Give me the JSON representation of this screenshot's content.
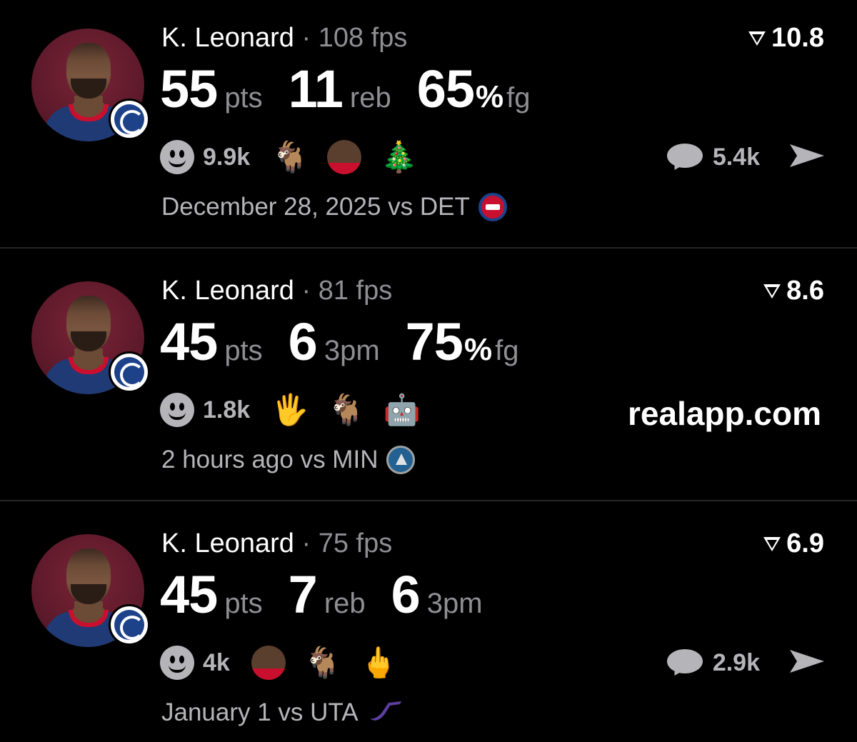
{
  "cards": [
    {
      "player": "K. Leonard",
      "separator": "·",
      "fps": "108 fps",
      "rating": "10.8",
      "stats": [
        {
          "value": "55",
          "unit": "pts"
        },
        {
          "value": "11",
          "unit": "reb"
        },
        {
          "value": "65",
          "pct": "%",
          "unit": "fg"
        }
      ],
      "reaction_count": "9.9k",
      "emojis": [
        "goat-emoji",
        "player-face-emoji",
        "christmas-tree-emoji"
      ],
      "emoji_glyphs": [
        "🐐",
        "🎄"
      ],
      "comment_count": "5.4k",
      "meta": "December 28, 2025 vs DET",
      "team_logo": "pistons-logo"
    },
    {
      "player": "K. Leonard",
      "separator": "·",
      "fps": "81 fps",
      "rating": "8.6",
      "stats": [
        {
          "value": "45",
          "unit": "pts"
        },
        {
          "value": "6",
          "unit": "3pm"
        },
        {
          "value": "75",
          "pct": "%",
          "unit": "fg"
        }
      ],
      "reaction_count": "1.8k",
      "emojis": [
        "raised-hand-emoji",
        "goat-emoji",
        "robot-emoji"
      ],
      "emoji_glyphs": [
        "🖐",
        "🐐",
        "🤖"
      ],
      "watermark": "realapp.com",
      "meta": "2 hours ago vs MIN",
      "team_logo": "timberwolves-logo"
    },
    {
      "player": "K. Leonard",
      "separator": "·",
      "fps": "75 fps",
      "rating": "6.9",
      "stats": [
        {
          "value": "45",
          "unit": "pts"
        },
        {
          "value": "7",
          "unit": "reb"
        },
        {
          "value": "6",
          "unit": "3pm"
        }
      ],
      "reaction_count": "4k",
      "emojis": [
        "player-face-emoji",
        "goat-emoji",
        "middle-finger-emoji"
      ],
      "emoji_glyphs": [
        "🐐",
        "🖕"
      ],
      "comment_count": "2.9k",
      "meta": "January 1 vs UTA",
      "team_logo": "jazz-logo"
    }
  ],
  "icons": {
    "rating": "flag-icon",
    "reaction": "smiley-icon",
    "comment": "speech-bubble-icon",
    "share": "send-arrow-icon"
  },
  "colors": {
    "background": "#000000",
    "primary_text": "#ffffff",
    "secondary_text": "#8e8e93",
    "muted": "#b5b5b9",
    "avatar_bg": "#5e1a2b"
  }
}
